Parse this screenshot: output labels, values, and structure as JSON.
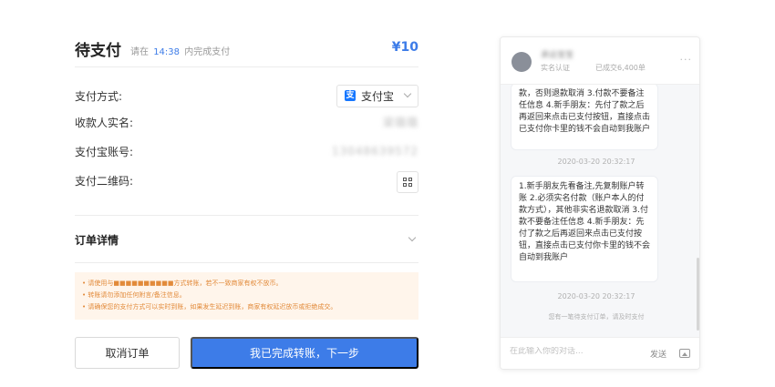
{
  "payment": {
    "title": "待支付",
    "timer_prefix": "请在",
    "timer_time": "14:38",
    "timer_suffix": "内完成支付",
    "amount": "¥10",
    "fields": {
      "method_label": "支付方式:",
      "method_value": "支付宝",
      "payee_name_label": "收款人实名:",
      "payee_name_value": "梁璐璐",
      "account_label": "支付宝账号:",
      "account_value": "13048639572",
      "qrcode_label": "支付二维码:"
    },
    "order_detail_label": "订单详情",
    "notices": [
      "请使用与■■■■■■■■■■方式转账，若不一致商家有权不放币。",
      "转账请勿添加任何附言/备注信息。",
      "请确保您的支付方式可以实时到账，如果发生延迟到账，商家有权延迟放币或拒绝成交。"
    ],
    "cancel_button": "取消订单",
    "done_button": "我已完成转账，下一步"
  },
  "chat": {
    "merchant_name": "承运宝宝",
    "badge_real": "实名认证",
    "badge_deals": "已成交6,400单",
    "more_icon": "more-icon",
    "messages": [
      {
        "text": "款，否则退款取消 3.付款不要备注任信息 4.新手朋友：先付了款之后再返回来点击已支付按钮，直接点击已支付你卡里的钱不会自动到我账户",
        "timestamp": "2020-03-20 20:32:17"
      },
      {
        "text": "1.新手朋友先看备注,先复制账户转账 2.必须实名付款（账户本人的付款方式），其他非实名退款取消 3.付款不要备注任信息 4.新手朋友：先付了款之后再返回来点击已支付按钮，直接点击已支付你卡里的钱不会自动到我账户",
        "timestamp": "2020-03-20 20:32:17"
      }
    ],
    "system_message": "您有一笔待支付订单，请及时支付",
    "input_placeholder": "在此输入你的对话...",
    "send_label": "发送"
  },
  "colors": {
    "accent": "#3d7ce8",
    "notice_bg": "#fff5eb",
    "notice_text": "#e28a3a",
    "alipay": "#1677ff"
  }
}
